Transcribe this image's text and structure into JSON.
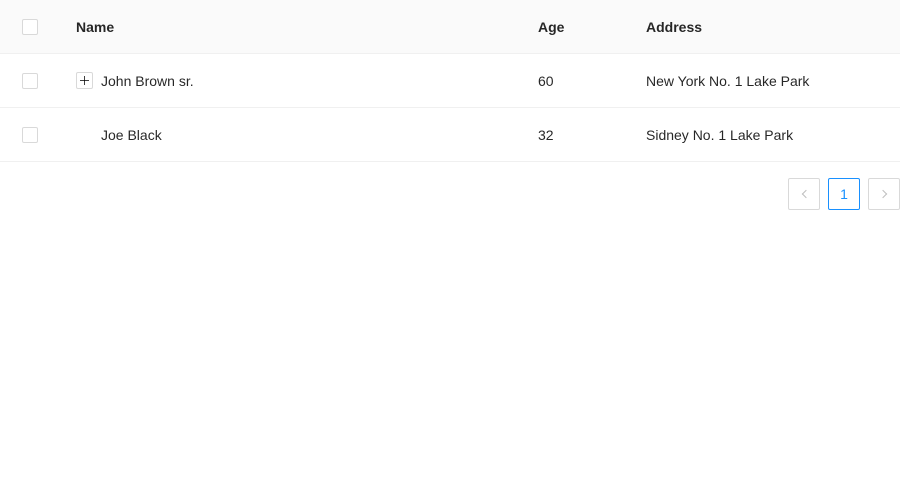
{
  "table": {
    "columns": {
      "name": "Name",
      "age": "Age",
      "address": "Address"
    },
    "rows": [
      {
        "name": "John Brown sr.",
        "age": "60",
        "address": "New York No. 1 Lake Park",
        "expandable": true
      },
      {
        "name": "Joe Black",
        "age": "32",
        "address": "Sidney No. 1 Lake Park",
        "expandable": false
      }
    ]
  },
  "pagination": {
    "current_page": "1",
    "prev_icon": "chevron-left-icon",
    "next_icon": "chevron-right-icon"
  },
  "colors": {
    "accent": "#1890ff",
    "header_bg": "#fafafa",
    "border": "#f0f0f0"
  }
}
